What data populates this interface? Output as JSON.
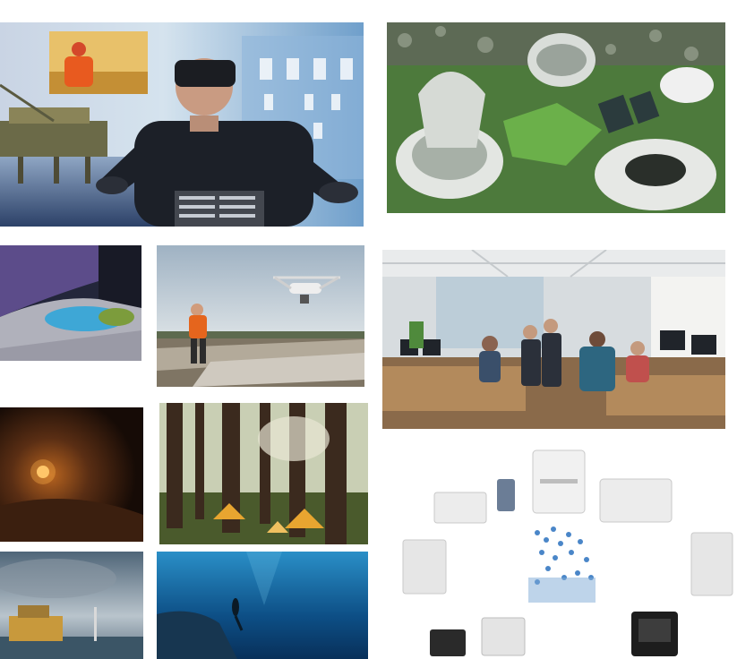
{
  "header": {
    "title_fragment": ""
  },
  "tiles": [
    {
      "id": "vr-offshore",
      "subject": "person-wearing-vr-headset-with-offshore-platform"
    },
    {
      "id": "lunar-habitat",
      "subject": "futuristic-habitat-modules-on-green-surface"
    },
    {
      "id": "immersive-room",
      "subject": "curved-immersive-projection-room"
    },
    {
      "id": "drone-survey",
      "subject": "surveyor-with-drone-over-quarry"
    },
    {
      "id": "control-room",
      "subject": "open-office-with-people-at-computers"
    },
    {
      "id": "cave",
      "subject": "dark-cave-with-lantern"
    },
    {
      "id": "forest-camp",
      "subject": "tents-among-tall-redwood-trees"
    },
    {
      "id": "portable-kits",
      "subject": "portable-equipment-cases-around-world-map"
    },
    {
      "id": "offshore-rig",
      "subject": "offshore-oil-rig-under-cloudy-sky"
    },
    {
      "id": "diver",
      "subject": "free-diver-in-deep-blue-ocean"
    }
  ]
}
